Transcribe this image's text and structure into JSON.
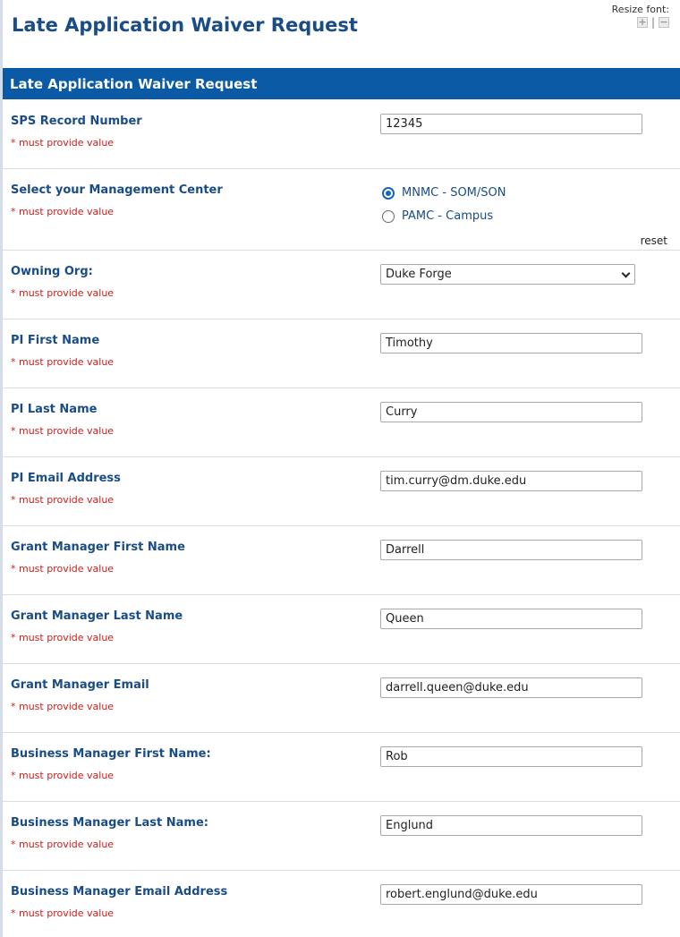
{
  "page_title": "Late Application Waiver Request",
  "resize_font": {
    "label": "Resize font:",
    "increase_glyph": "+",
    "separator": "|",
    "decrease_glyph": "−"
  },
  "section_header": "Late Application Waiver Request",
  "required_note": "* must provide value",
  "fields": {
    "sps_record": {
      "label": "SPS Record Number",
      "value": "12345"
    },
    "mgmt_center": {
      "label": "Select your Management Center",
      "options": [
        "MNMC - SOM/SON",
        "PAMC - Campus"
      ],
      "selected": "MNMC - SOM/SON",
      "reset_label": "reset"
    },
    "owning_org": {
      "label": "Owning Org:",
      "value": "Duke Forge"
    },
    "pi_first": {
      "label": "PI First Name",
      "value": "Timothy"
    },
    "pi_last": {
      "label": "PI Last Name",
      "value": "Curry"
    },
    "pi_email": {
      "label": "PI Email Address",
      "value": "tim.curry@dm.duke.edu"
    },
    "gm_first": {
      "label": "Grant Manager First Name",
      "value": "Darrell"
    },
    "gm_last": {
      "label": "Grant Manager Last Name",
      "value": "Queen"
    },
    "gm_email": {
      "label": "Grant Manager Email",
      "value": "darrell.queen@duke.edu"
    },
    "bm_first": {
      "label": "Business Manager First Name:",
      "value": "Rob"
    },
    "bm_last": {
      "label": "Business Manager Last Name:",
      "value": "Englund"
    },
    "bm_email": {
      "label": "Business Manager Email Address",
      "value": "robert.englund@duke.edu"
    }
  },
  "colors": {
    "accent": "#0b5aa6",
    "label": "#1a4c85",
    "required": "#d21b1b"
  }
}
